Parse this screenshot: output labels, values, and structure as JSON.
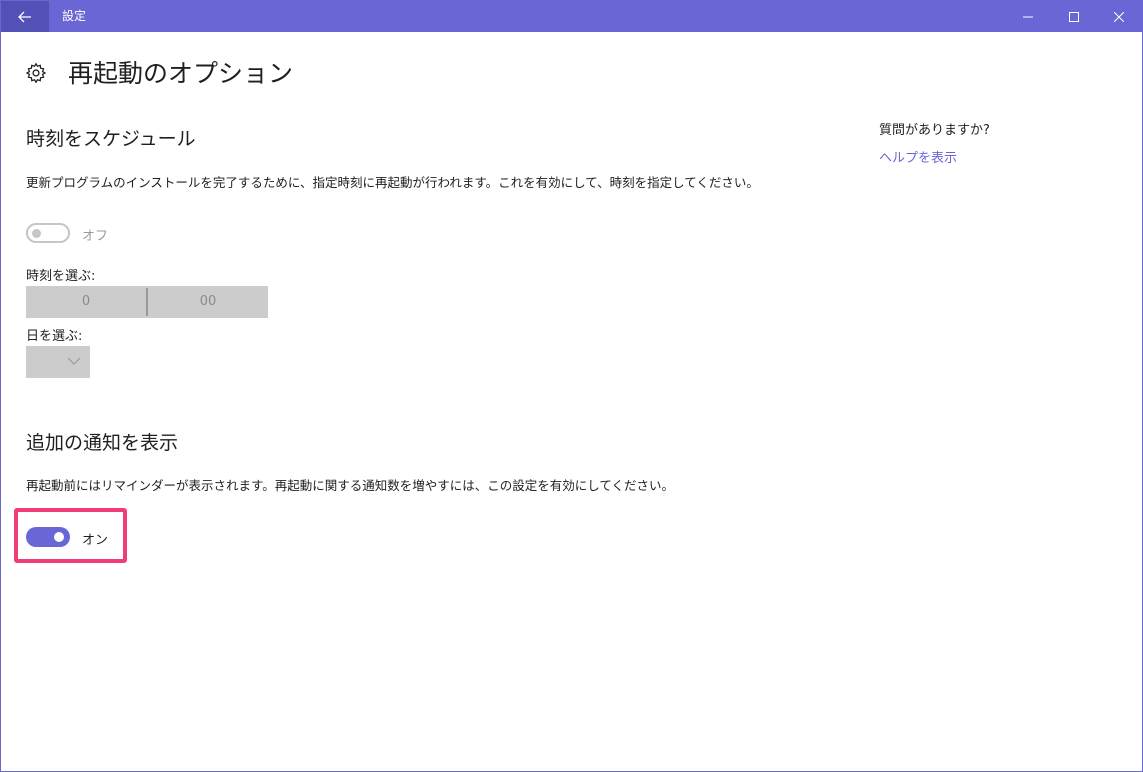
{
  "window": {
    "title": "設定"
  },
  "page": {
    "title": "再起動のオプション"
  },
  "schedule": {
    "heading": "時刻をスケジュール",
    "description": "更新プログラムのインストールを完了するために、指定時刻に再起動が行われます。これを有効にして、時刻を指定してください。",
    "toggle_state": "オフ",
    "time_label": "時刻を選ぶ:",
    "hour_value": "0",
    "minute_value": "00",
    "day_label": "日を選ぶ:"
  },
  "notifications": {
    "heading": "追加の通知を表示",
    "description": "再起動前にはリマインダーが表示されます。再起動に関する通知数を増やすには、この設定を有効にしてください。",
    "toggle_state": "オン"
  },
  "sidebar": {
    "question": "質問がありますか?",
    "help_link": "ヘルプを表示"
  },
  "colors": {
    "accent": "#6b66d6",
    "highlight": "#f23c78"
  }
}
